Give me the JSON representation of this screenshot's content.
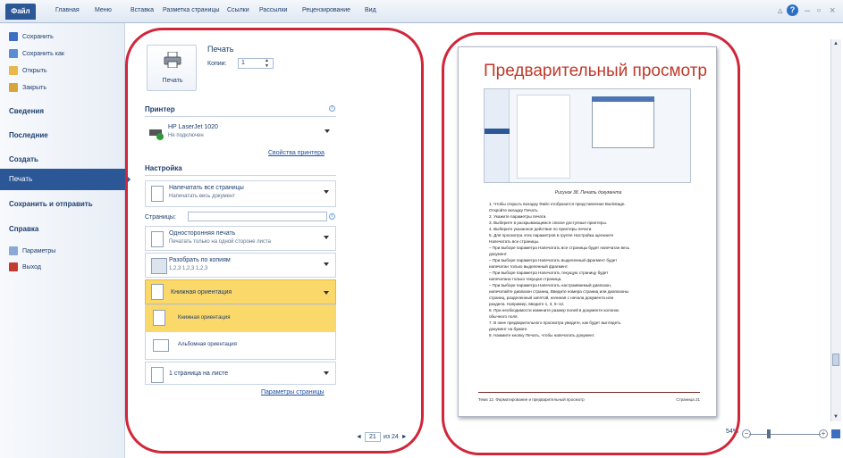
{
  "ribbon": {
    "file_tab": "Файл",
    "tabs": [
      "Главная",
      "Меню",
      "Вставка",
      "Разметка страницы",
      "Ссылки",
      "Рассылки",
      "Рецензирование",
      "Вид"
    ]
  },
  "backstage": {
    "small_items": [
      {
        "label": "Сохранить",
        "icon": "save-icon"
      },
      {
        "label": "Сохранить как",
        "icon": "save-as-icon"
      },
      {
        "label": "Открыть",
        "icon": "open-folder-icon"
      },
      {
        "label": "Закрыть",
        "icon": "close-folder-icon"
      }
    ],
    "big_items": [
      "Сведения",
      "Последние",
      "Создать"
    ],
    "selected": "Печать",
    "send": "Сохранить и отправить",
    "help": "Справка",
    "params": "Параметры",
    "exit": "Выход"
  },
  "print": {
    "title": "Печать",
    "button_label": "Печать",
    "copies_label": "Копии:",
    "copies_value": "1",
    "printer_heading": "Принтер",
    "printer_name": "HP LaserJet 1020",
    "printer_status": "Не подключен",
    "printer_props_link": "Свойства принтера",
    "settings_heading": "Настройка",
    "print_all_main": "Напечатать все страницы",
    "print_all_sub": "Напечатать весь документ",
    "pages_label": "Страницы:",
    "pages_value": "",
    "sides_main": "Односторонняя печать",
    "sides_sub": "Печатать только на одной стороне листа",
    "collate_main": "Разобрать по копиям",
    "collate_sub": "1,2,3   1,2,3   1,2,3",
    "orientation_current": "Книжная ориентация",
    "orientation_options": [
      "Книжная ориентация",
      "Альбомная ориентация"
    ],
    "per_sheet": "1 страница на листе",
    "page_setup_link": "Параметры страницы"
  },
  "pager": {
    "prev": "◄",
    "current": "21",
    "of_label": "из 24",
    "next": "►"
  },
  "preview": {
    "title": "Предварительный просмотр",
    "caption": "Рисунок 38. Печать документа",
    "lines": [
      "1.  Чтобы открыть вкладку Файл отобразится представление Backstage.",
      "    Откройте вкладку Печать.",
      "2.  Укажите параметры печати.",
      "3.  Выберите в раскрывающемся списке доступные принтеры.",
      "4.  Выберите указанное действие по принтеры печати.",
      "5.  Для просмотра этих параметров в группе Настройка щелкните",
      "    Напечатать все страницы.",
      "    –  При выборе параметра Напечатать все страницы будет напечатан весь",
      "       документ.",
      "    –  При выборе параметра Напечатать выделенный фрагмент будет",
      "       напечатан только выделенный фрагмент.",
      "    –  При выборе параметра Напечатать текущую страницу будет",
      "       напечатана только текущая страница.",
      "    –  При выборе параметра Напечатать настраиваемый диапазон,",
      "       напечатайте диапазон страниц. Введите номера страниц или диапазоны",
      "       страниц, разделенный запятой, начиная с начала документа или",
      "       раздела. Например, введите 1, 3, 5–12.",
      "6.  При необходимости измените размер полей в документе колонок",
      "    обычного поля.",
      "7.  В окне предварительного просмотра увидите, как будет выглядеть",
      "    документ на бумаге.",
      "8.  Нажмите кнопку Печать, чтобы напечатать документ."
    ],
    "footer_left": "Тема 12. Форматирование и предварительный просмотр",
    "footer_right": "Страница 21"
  },
  "zoom": {
    "level": "54%",
    "minus": "−",
    "plus": "+"
  },
  "colors": {
    "accent": "#2b5797",
    "highlight": "#fbd86a",
    "annotation_red": "#d1263a",
    "title_red": "#c0392b"
  }
}
